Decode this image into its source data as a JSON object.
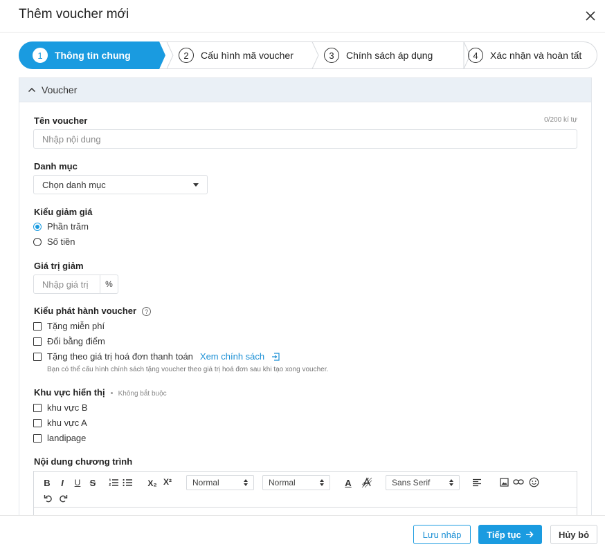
{
  "dialog": {
    "title": "Thêm voucher mới"
  },
  "steps": [
    {
      "num": "1",
      "label": "Thông tin chung",
      "active": true
    },
    {
      "num": "2",
      "label": "Cấu hình mã voucher"
    },
    {
      "num": "3",
      "label": "Chính sách áp dụng"
    },
    {
      "num": "4",
      "label": "Xác nhận và hoàn tất"
    }
  ],
  "colors": {
    "accent": "#1a9be0",
    "link": "#1a8fd5",
    "panel_header": "#eaf0f6"
  },
  "section": {
    "title": "Voucher"
  },
  "name_field": {
    "label": "Tên voucher",
    "counter": "0/200 kí tự",
    "placeholder": "Nhập nội dung"
  },
  "category": {
    "label": "Danh mục",
    "selected": "Chọn danh mục"
  },
  "discount_type": {
    "label": "Kiểu giảm giá",
    "options": [
      "Phần trăm",
      "Số tiền"
    ],
    "selected_index": 0
  },
  "discount_value": {
    "label": "Giá trị giảm",
    "placeholder": "Nhập giá trị",
    "unit": "%"
  },
  "issue_type": {
    "label": "Kiểu phát hành voucher",
    "help_icon": "?",
    "options": [
      "Tặng miễn phí",
      "Đổi bằng điểm",
      "Tặng theo giá trị hoá đơn thanh toán"
    ],
    "policy_link": "Xem chính sách",
    "hint": "Bạn có thể cấu hình chính sách tặng voucher theo giá trị hoá đơn sau khi tạo xong voucher."
  },
  "display_area": {
    "label": "Khu vực hiển thị",
    "optional": "Không bắt buộc",
    "options": [
      "khu vực B",
      "khu vực A",
      "landipage"
    ]
  },
  "content": {
    "label": "Nội dung chương trình",
    "toolbar": {
      "bold": "B",
      "italic": "I",
      "underline": "U",
      "strike": "S",
      "sub": "X₂",
      "sup": "X²",
      "header_select": "Normal",
      "size_select": "Normal",
      "font_select": "Sans Serif",
      "text_color": "A"
    }
  },
  "footer": {
    "draft": "Lưu nháp",
    "next": "Tiếp tục",
    "cancel": "Hủy bỏ"
  }
}
